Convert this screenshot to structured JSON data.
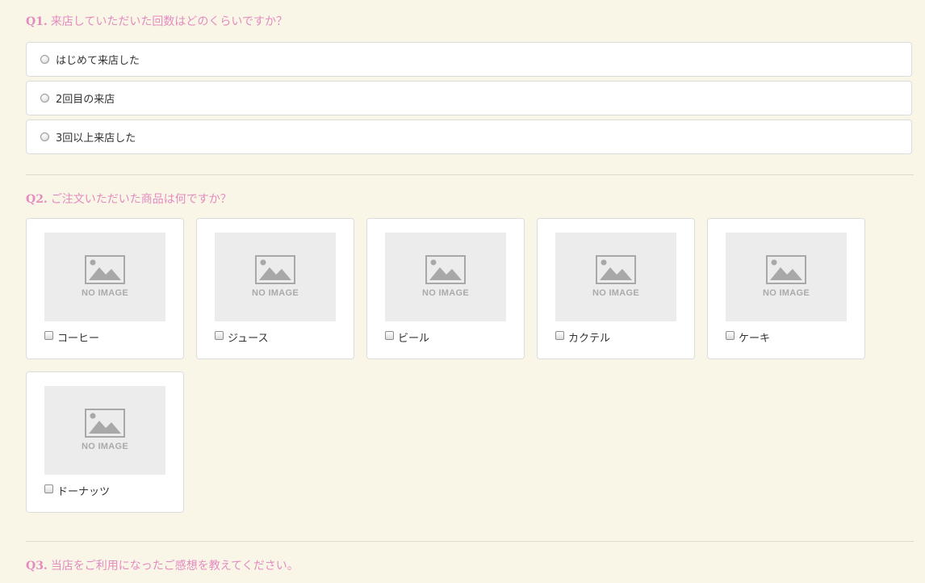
{
  "q1": {
    "number": "Q1.",
    "text": "来店していただいた回数はどのくらいですか？",
    "options": [
      {
        "label": "はじめて来店した"
      },
      {
        "label": "2回目の来店"
      },
      {
        "label": "3回以上来店した"
      }
    ]
  },
  "q2": {
    "number": "Q2.",
    "text": "ご注文いただいた商品は何ですか？",
    "placeholder_text": "NO IMAGE",
    "items": [
      {
        "label": "コーヒー"
      },
      {
        "label": "ジュース"
      },
      {
        "label": "ビール"
      },
      {
        "label": "カクテル"
      },
      {
        "label": "ケーキ"
      },
      {
        "label": "ドーナッツ"
      }
    ]
  },
  "q3": {
    "number": "Q3.",
    "text": "当店をご利用になったご感想を教えてください。"
  },
  "colors": {
    "background": "#f9f6e8",
    "question_accent": "#e48bbf",
    "card_border": "#dcdcdc",
    "placeholder_bg": "#ececec"
  }
}
